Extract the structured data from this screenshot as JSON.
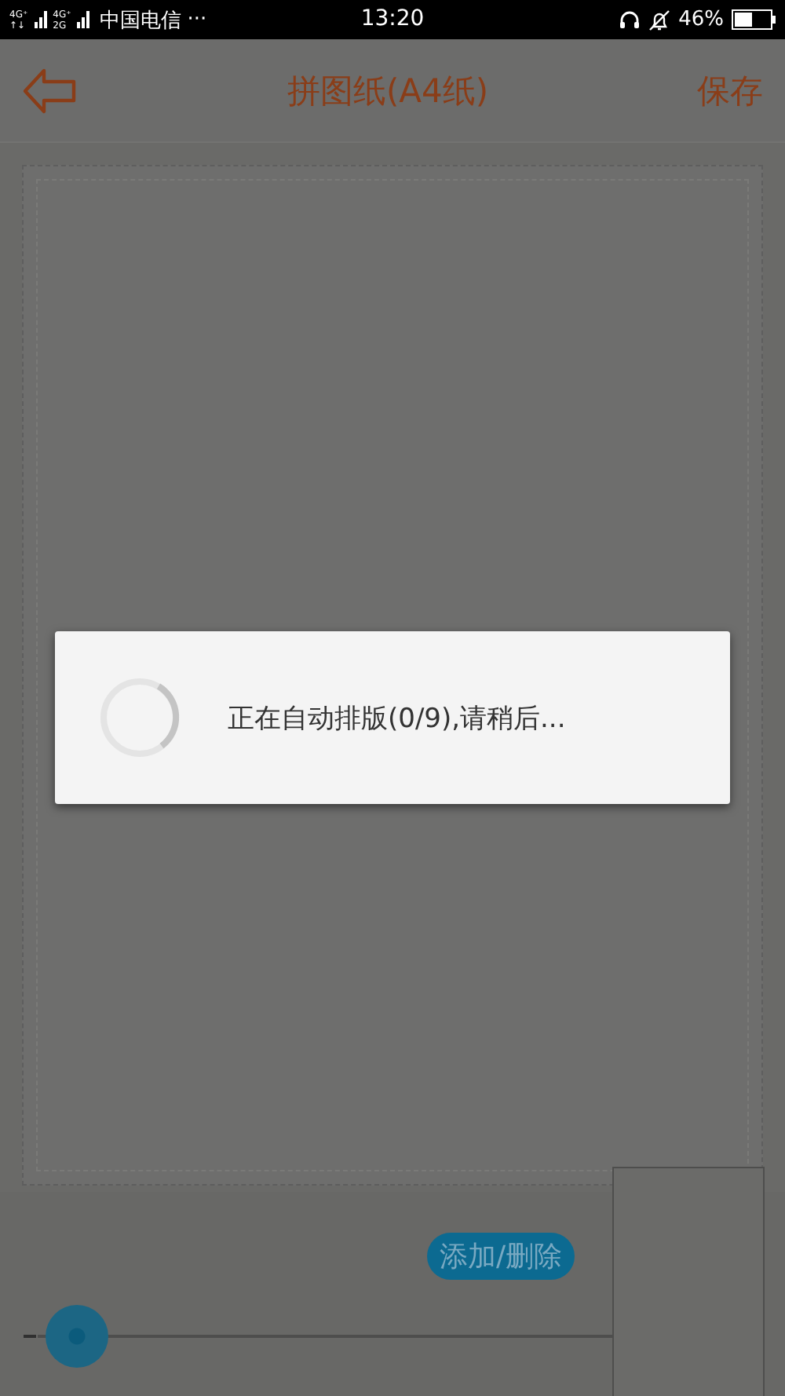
{
  "status_bar": {
    "networks": [
      {
        "top": "4G⁺",
        "bottom": "↑↓"
      },
      {
        "top": "4G⁺",
        "bottom": "2G"
      }
    ],
    "carrier": "中国电信",
    "more": "···",
    "time": "13:20",
    "battery": "46%"
  },
  "header": {
    "title": "拼图纸(A4纸)",
    "action": "保存"
  },
  "toolbar": {
    "button": "添加/删除"
  },
  "slider": {
    "level": 0.02
  },
  "dialog": {
    "message": "正在自动排版(0/9),请稍后..."
  }
}
